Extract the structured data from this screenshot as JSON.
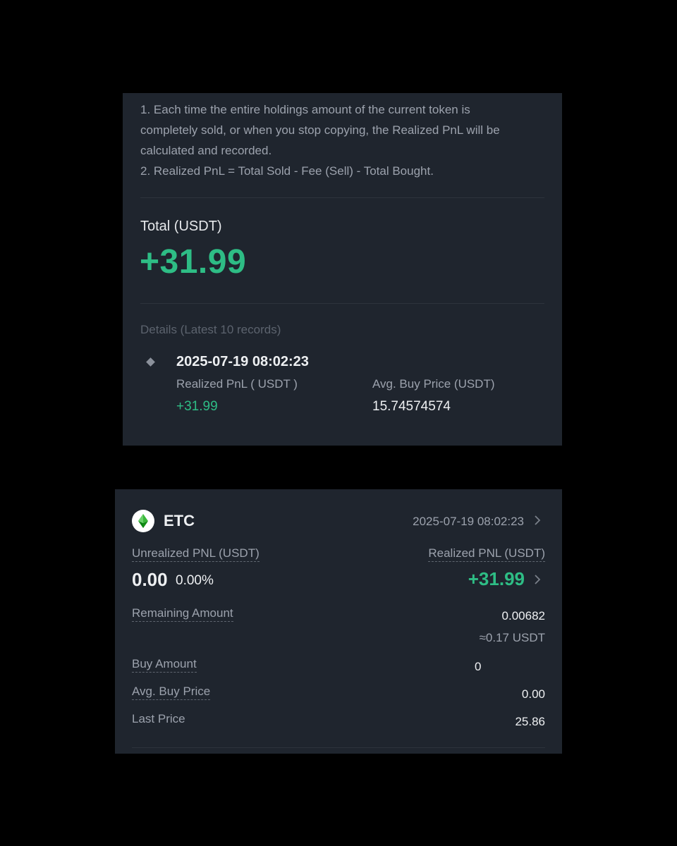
{
  "realized_panel": {
    "notes": [
      "1. Each time the entire holdings amount of the current token is",
      "completely sold, or when you stop copying, the Realized PnL will be",
      "calculated and recorded.",
      "2. Realized PnL = Total Sold - Fee (Sell) - Total Bought."
    ],
    "total_label": "Total (USDT)",
    "total_value": "+31.99",
    "details_label": "Details (Latest 10 records)",
    "record": {
      "time": "2025-07-19 08:02:23",
      "realized_label": "Realized PnL ( USDT )",
      "realized_value": "+31.99",
      "avg_label": "Avg. Buy Price (USDT)",
      "avg_value": "15.74574574"
    }
  },
  "position_card": {
    "coin": "ETC",
    "coin_icon": "ethereum-classic-icon",
    "time": "2025-07-19 08:02:23",
    "unrealized_label": "Unrealized PNL (USDT)",
    "unrealized_value": "0.00",
    "unrealized_pct": "0.00%",
    "realized_label": "Realized PNL (USDT)",
    "realized_value": "+31.99",
    "remaining_label": "Remaining Amount",
    "remaining_value": "0.00682",
    "remaining_usdt": "≈0.17 USDT",
    "buy_amount_label": "Buy Amount",
    "buy_amount_value": "0",
    "avg_buy_label": "Avg. Buy Price",
    "avg_buy_value": "0.00",
    "last_price_label": "Last Price",
    "last_price_value": "25.86"
  },
  "colors": {
    "page_bg": "#000000",
    "panel_bg": "#1f252e",
    "positive": "#2ebd85",
    "text_primary": "#eef0f2",
    "text_secondary": "#9ca2ad"
  }
}
